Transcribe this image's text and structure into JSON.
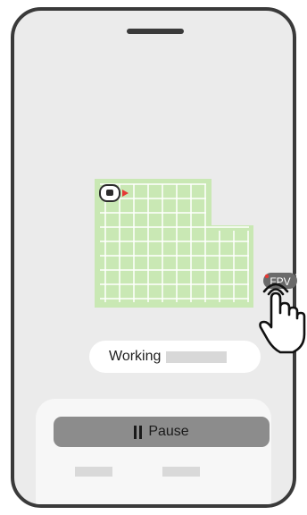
{
  "status": {
    "text": "Working"
  },
  "controls": {
    "pause_label": "Pause"
  },
  "fpv": {
    "label": "FPV"
  },
  "map": {
    "fill_color": "#c9e8b4",
    "grid_color": "#ffffff",
    "indicator_color": "#e53935"
  },
  "icons": {
    "robot": "robot-mower-icon",
    "direction": "direction-arrow-icon",
    "hand": "tap-hand-icon",
    "pause": "pause-icon"
  }
}
